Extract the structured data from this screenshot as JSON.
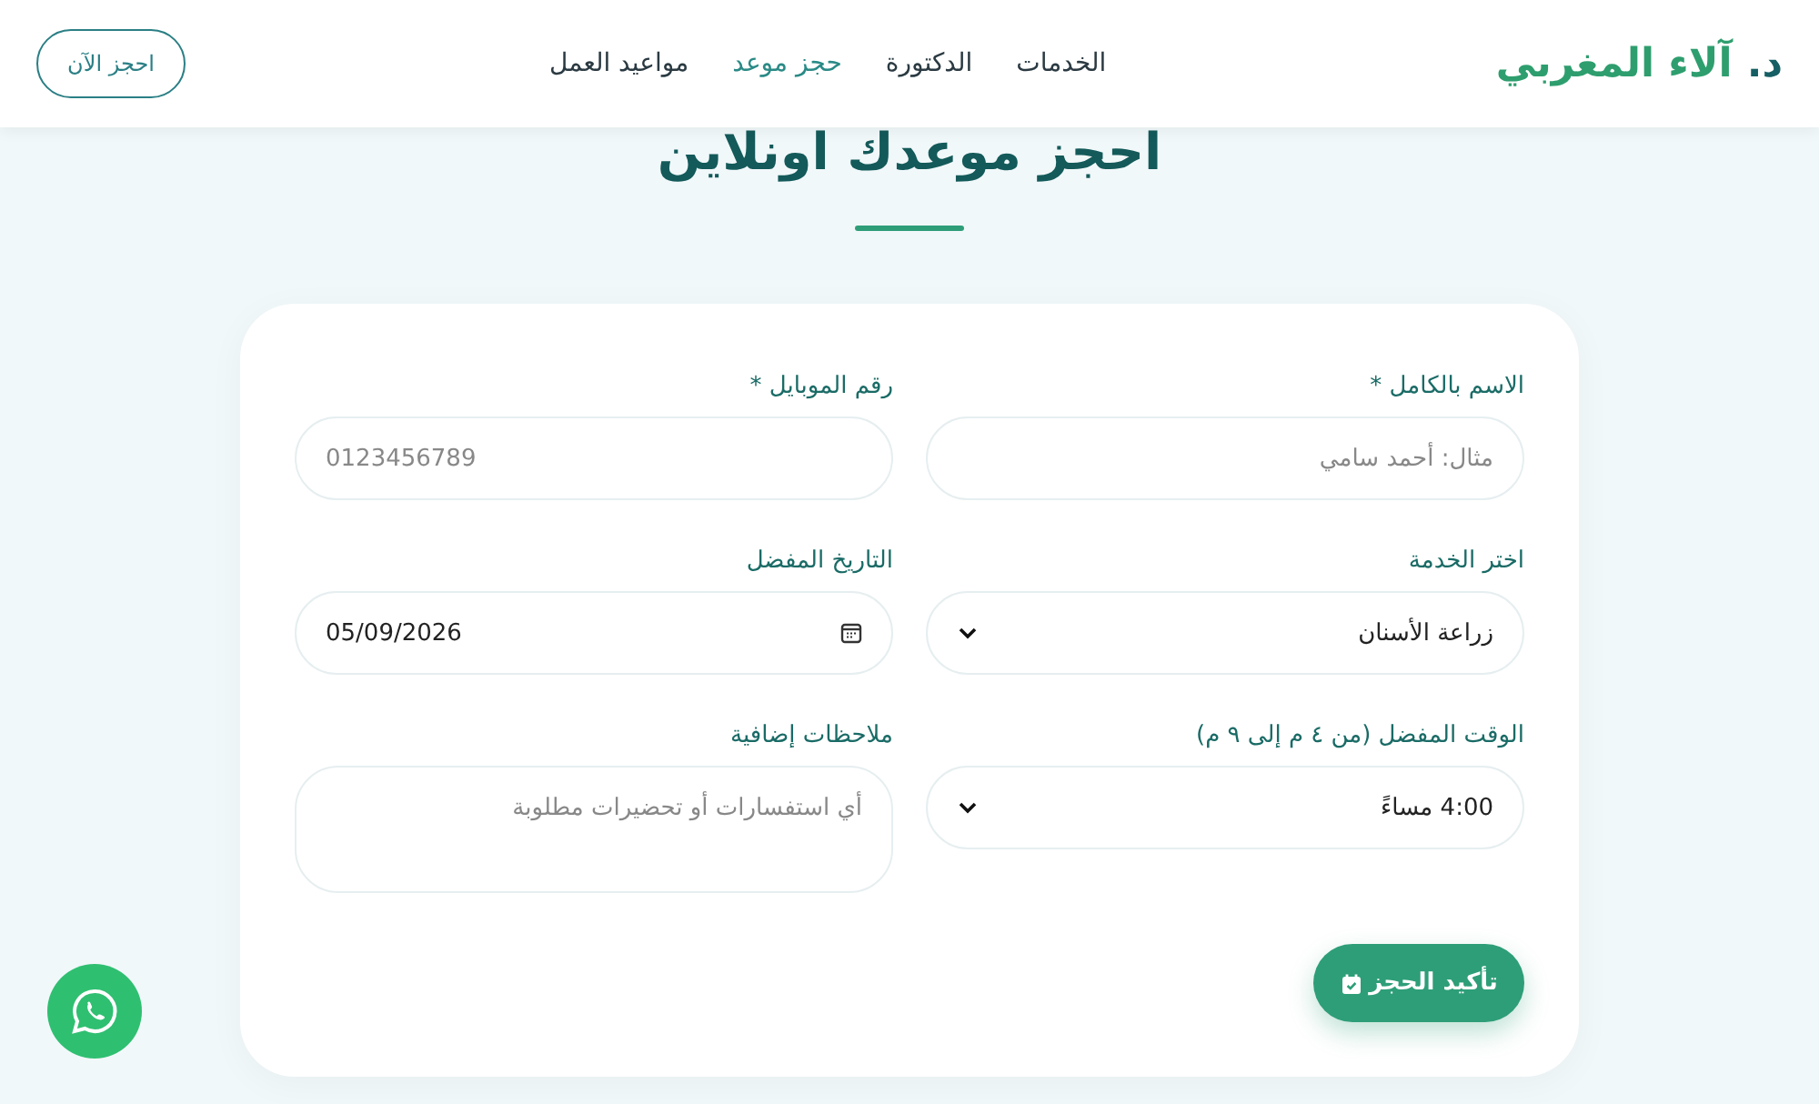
{
  "header": {
    "logo": {
      "prefix": "د.",
      "name": "آلاء المغربي"
    },
    "nav": [
      {
        "label": "الخدمات",
        "selected": false
      },
      {
        "label": "الدكتورة",
        "selected": false
      },
      {
        "label": "حجز موعد",
        "selected": true
      },
      {
        "label": "مواعيد العمل",
        "selected": false
      }
    ],
    "cta": "احجز الآن"
  },
  "title": "احجز موعدك اونلاين",
  "form": {
    "fields": [
      {
        "kind": "text",
        "label": "الاسم بالكامل *",
        "placeholder": "مثال: أحمد سامي"
      },
      {
        "kind": "tel",
        "label": "رقم الموبايل *",
        "placeholder": "0123456789"
      },
      {
        "kind": "select",
        "label": "اختر الخدمة",
        "value": "زراعة الأسنان"
      },
      {
        "kind": "date",
        "label": "التاريخ المفضل",
        "value": "05/09/2026"
      },
      {
        "kind": "select",
        "label": "الوقت المفضل (من ٤ م إلى ٩ م)",
        "value": "4:00 مساءً"
      },
      {
        "kind": "textarea",
        "label": "ملاحظات إضافية",
        "placeholder": "أي استفسارات أو تحضيرات مطلوبة"
      }
    ],
    "submit": "تأكيد الحجز"
  }
}
